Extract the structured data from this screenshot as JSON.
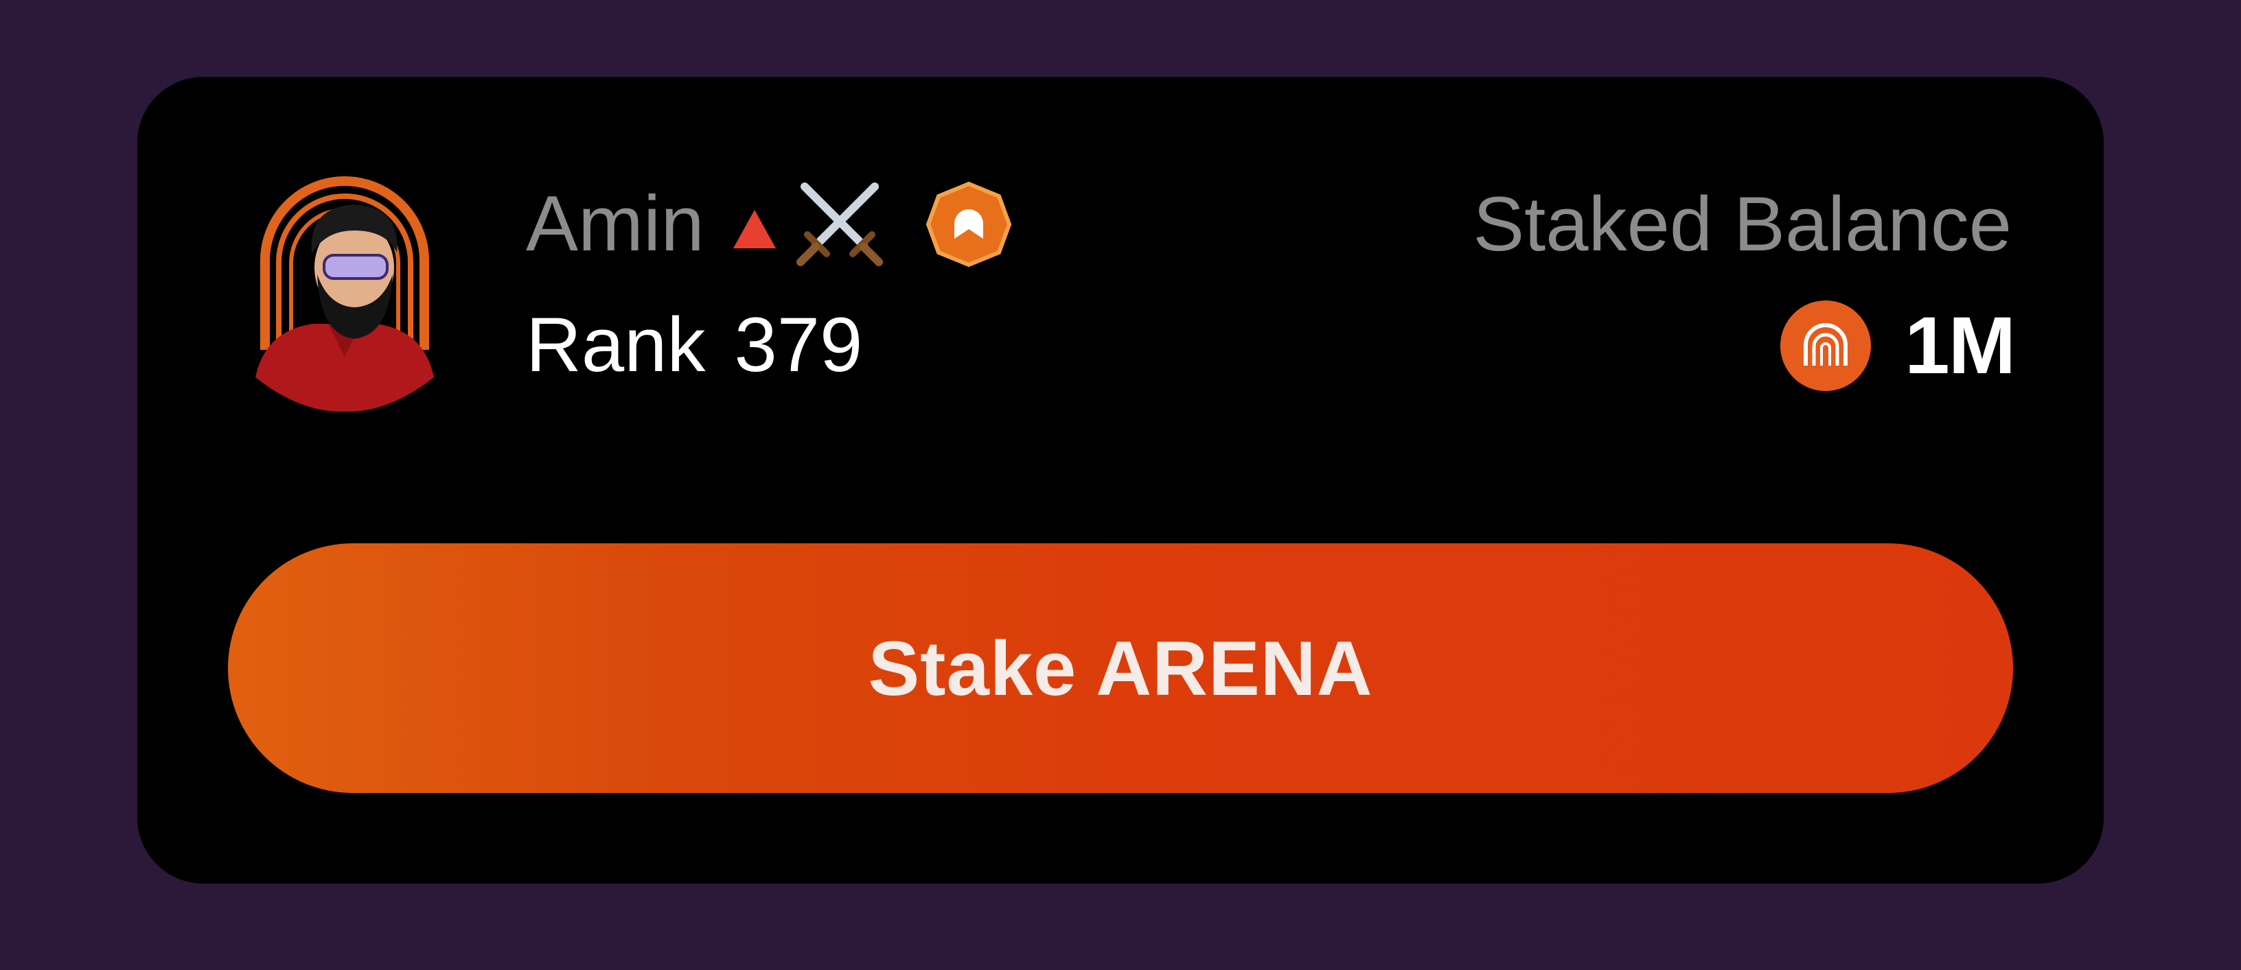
{
  "profile": {
    "name": "Amin",
    "rank_label": "Rank",
    "rank_value": "379",
    "icons": [
      "avatar-portrait",
      "trend-up-icon",
      "crossed-swords-icon",
      "arena-badge-icon"
    ]
  },
  "balance": {
    "label": "Staked Balance",
    "value": "1M",
    "token_icon": "arena-token-icon"
  },
  "actions": {
    "stake_label": "Stake ARENA"
  },
  "colors": {
    "page_background": "#2c1839",
    "card_background": "#000000",
    "muted_text": "#8c8c8c",
    "primary_text": "#ffffff",
    "accent_orange": "#dc3d0b",
    "accent_orange_light": "#e06010",
    "trend_red": "#e8402e"
  }
}
